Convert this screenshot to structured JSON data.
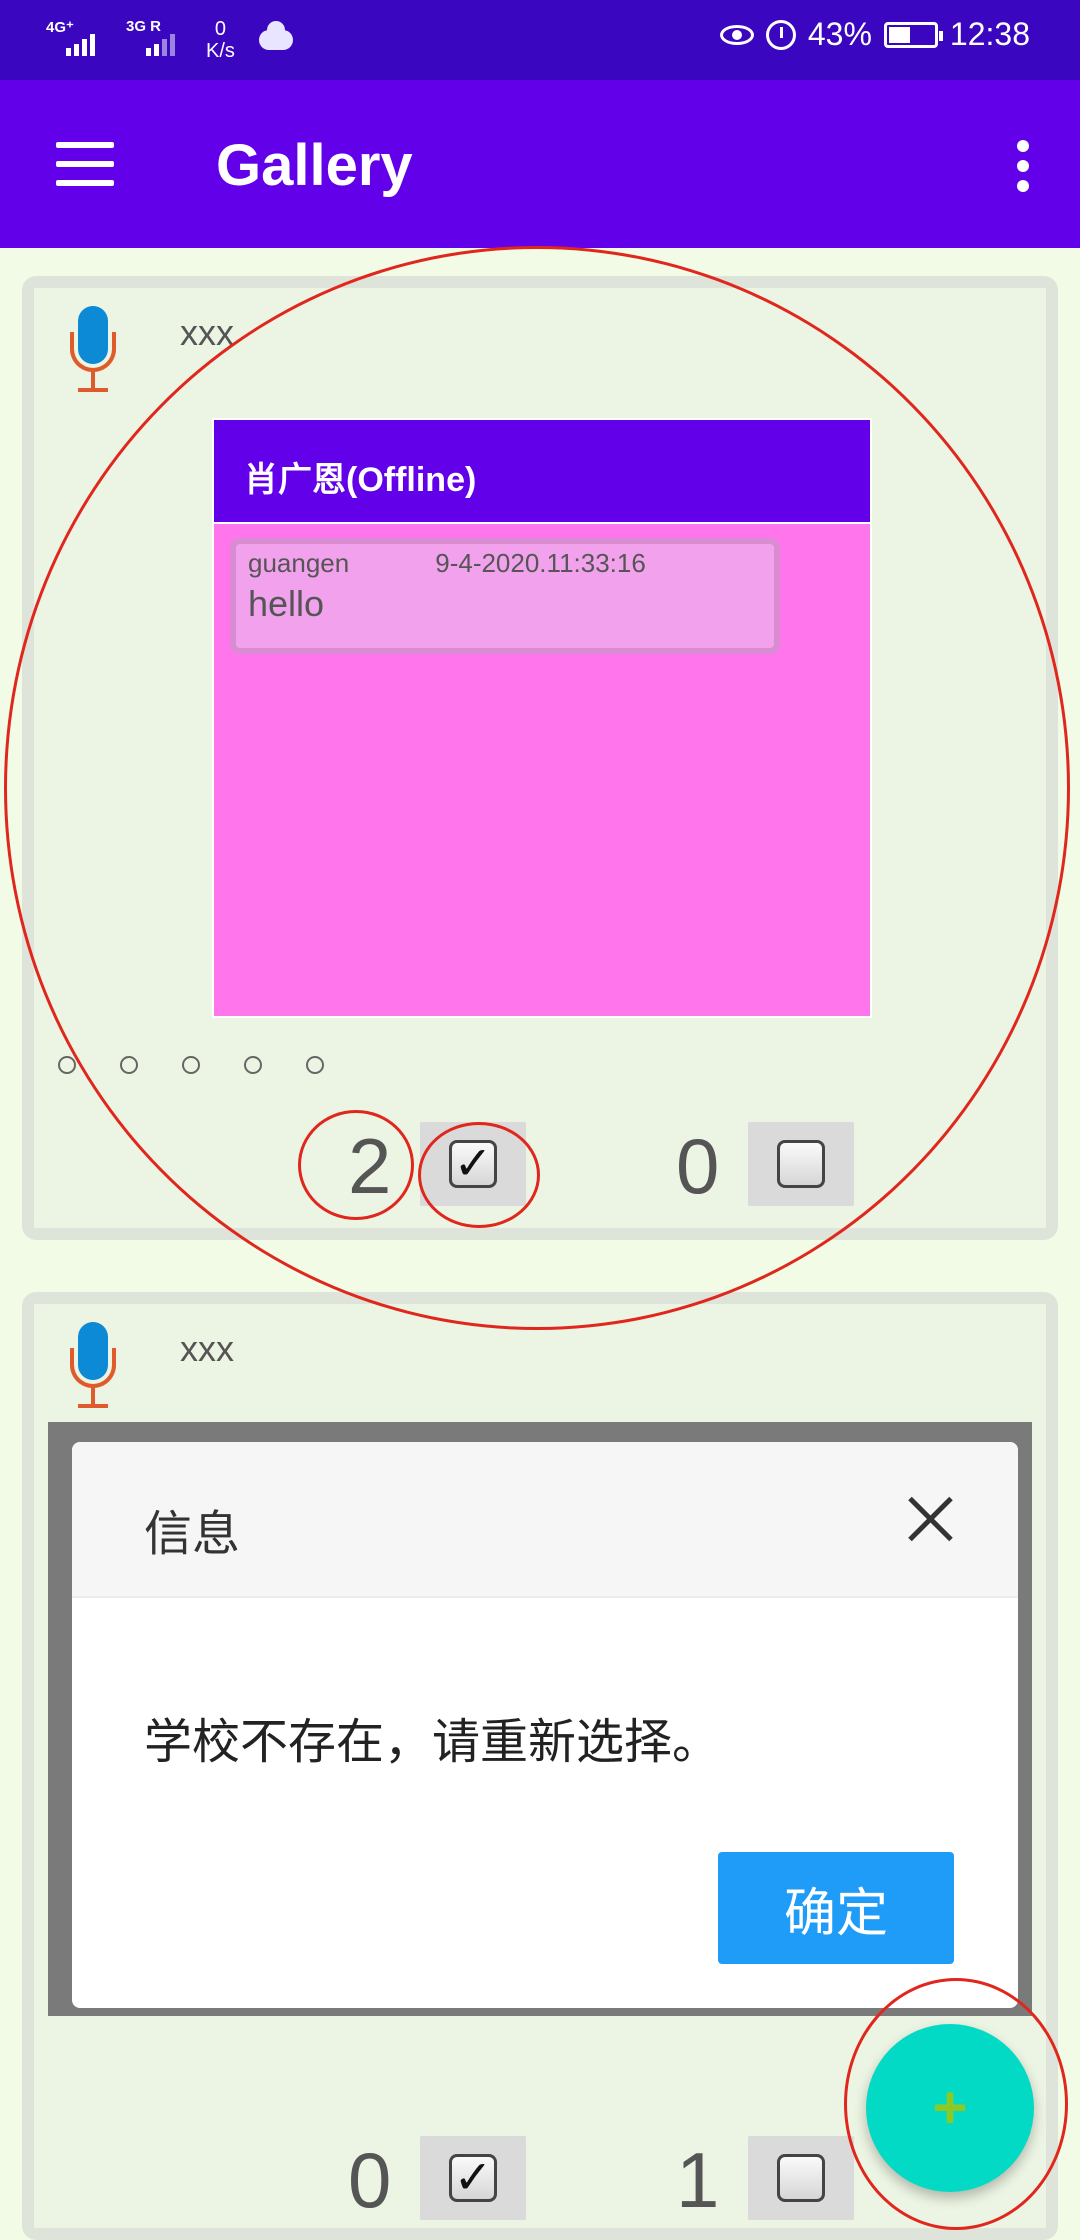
{
  "status_bar": {
    "signal1": "4G⁺",
    "signal2": "3G R",
    "speed_value": "0",
    "speed_unit": "K/s",
    "battery": "43%",
    "time": "12:38"
  },
  "app_bar": {
    "title": "Gallery"
  },
  "cards": [
    {
      "name": "xxx",
      "chat": {
        "header": "肖广恩(Offline)",
        "messages": [
          {
            "sender": "guangen",
            "timestamp": "9-4-2020.11:33:16",
            "text": "hello"
          }
        ]
      },
      "like_count": "2",
      "like_checked": true,
      "dislike_count": "0",
      "dislike_checked": false
    },
    {
      "name": "xxx",
      "dialog": {
        "title": "信息",
        "message": "学校不存在，请重新选择。",
        "ok_label": "确定"
      },
      "like_count": "0",
      "like_checked": true,
      "dislike_count": "1",
      "dislike_checked": false
    }
  ],
  "fab": {
    "label": "+"
  },
  "colors": {
    "status_bar": "#3a06c0",
    "app_bar": "#6200ea",
    "chat_bg": "#ff76ec",
    "fab": "#03dac5",
    "annotation": "#e0271e"
  }
}
